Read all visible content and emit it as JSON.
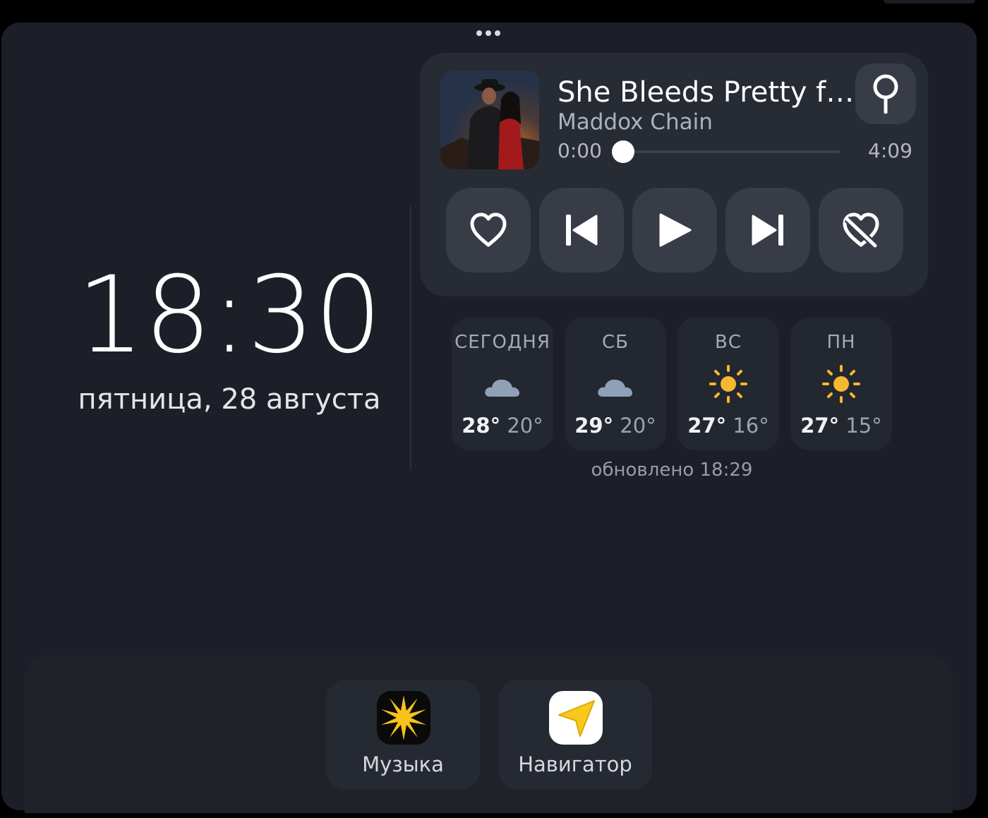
{
  "clock": {
    "time": "18:30",
    "date": "пятница, 28 августа"
  },
  "player": {
    "title": "She Bleeds Pretty f…",
    "artist": "Maddox Chain",
    "elapsed": "0:00",
    "duration": "4:09",
    "progress_fraction": 0.0,
    "controls": [
      "heart-icon",
      "previous-icon",
      "play-icon",
      "next-icon",
      "dislike-icon"
    ]
  },
  "weather": {
    "days": [
      {
        "name": "СЕГОДНЯ",
        "icon": "cloud-icon",
        "hi": "28°",
        "lo": "20°"
      },
      {
        "name": "СБ",
        "icon": "cloud-icon",
        "hi": "29°",
        "lo": "20°"
      },
      {
        "name": "ВС",
        "icon": "sun-icon",
        "hi": "27°",
        "lo": "16°"
      },
      {
        "name": "ПН",
        "icon": "sun-icon",
        "hi": "27°",
        "lo": "15°"
      }
    ],
    "updated": "обновлено 18:29"
  },
  "dock": {
    "apps": [
      {
        "label": "Музыка",
        "icon": "music-app-icon"
      },
      {
        "label": "Навигатор",
        "icon": "navigator-app-icon"
      }
    ]
  },
  "colors": {
    "background": "#1c1f27",
    "card": "#272b34",
    "button": "#383c47",
    "sun": "#f7b731",
    "cloud": "#8fa0b7",
    "navigator": "#f9c81c"
  }
}
